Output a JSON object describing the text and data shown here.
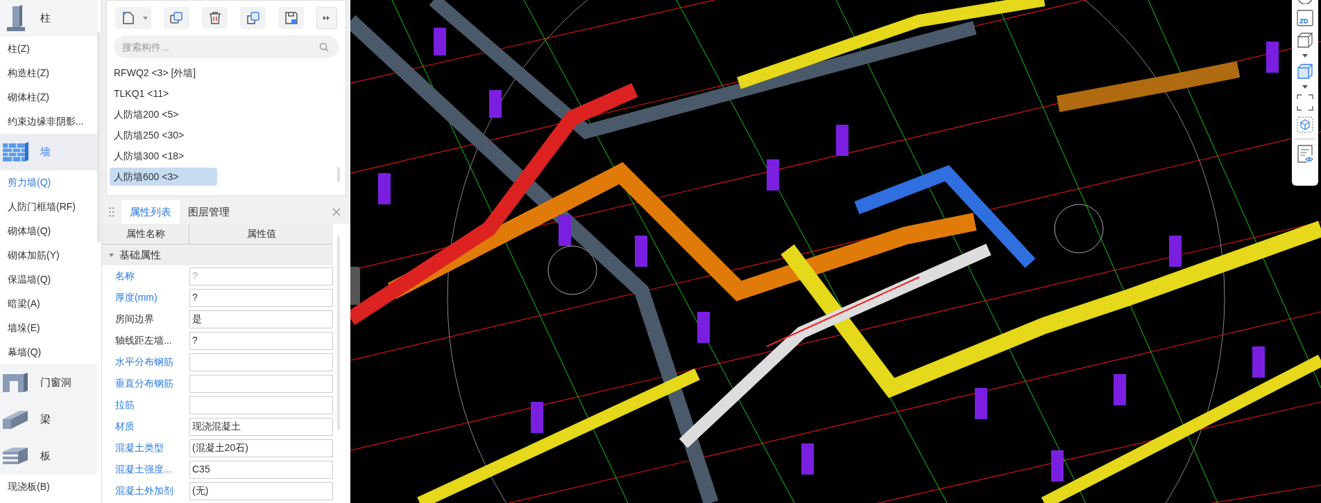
{
  "sidebar": {
    "categories": [
      {
        "label": "柱",
        "selected": false,
        "items": [
          {
            "label": "柱(Z)",
            "selected": false
          },
          {
            "label": "构造柱(Z)",
            "selected": false
          },
          {
            "label": "砌体柱(Z)",
            "selected": false
          },
          {
            "label": "约束边缘非阴影...",
            "selected": false
          }
        ]
      },
      {
        "label": "墙",
        "selected": true,
        "items": [
          {
            "label": "剪力墙(Q)",
            "selected": true
          },
          {
            "label": "人防门框墙(RF)",
            "selected": false
          },
          {
            "label": "砌体墙(Q)",
            "selected": false
          },
          {
            "label": "砌体加筋(Y)",
            "selected": false
          },
          {
            "label": "保温墙(Q)",
            "selected": false
          },
          {
            "label": "暗梁(A)",
            "selected": false
          },
          {
            "label": "墙垛(E)",
            "selected": false
          },
          {
            "label": "幕墙(Q)",
            "selected": false
          }
        ]
      },
      {
        "label": "门窗洞",
        "selected": false
      },
      {
        "label": "梁",
        "selected": false
      },
      {
        "label": "板",
        "selected": false,
        "items": [
          {
            "label": "现浇板(B)",
            "selected": false
          }
        ]
      }
    ]
  },
  "component_panel": {
    "search": {
      "placeholder": "搜索构件..."
    },
    "components": [
      {
        "label": "RFWQ2 <3> [外墙]",
        "selected": false
      },
      {
        "label": "TLKQ1 <11>",
        "selected": false
      },
      {
        "label": "人防墙200 <5>",
        "selected": false
      },
      {
        "label": "人防墙250 <30>",
        "selected": false
      },
      {
        "label": "人防墙300 <18>",
        "selected": false
      },
      {
        "label": "人防墙600 <3>",
        "selected": true
      }
    ]
  },
  "property_panel": {
    "tabs": [
      {
        "label": "属性列表",
        "selected": true
      },
      {
        "label": "图层管理",
        "selected": false
      }
    ],
    "columns": [
      "属性名称",
      "属性值"
    ],
    "group": {
      "label": "基础属性",
      "expanded": true
    },
    "rows": [
      {
        "name": "名称",
        "value": "?",
        "common": true,
        "dimmed": true
      },
      {
        "name": "厚度(mm)",
        "value": "?",
        "common": true,
        "dimmed": false
      },
      {
        "name": "房间边界",
        "value": "是",
        "common": false,
        "dimmed": false
      },
      {
        "name": "轴线距左墙...",
        "value": "?",
        "common": false,
        "dimmed": false
      },
      {
        "name": "水平分布钢筋",
        "common": true,
        "dimmed": false
      },
      {
        "name": "垂直分布钢筋",
        "common": true,
        "dimmed": false
      },
      {
        "name": "拉筋",
        "common": true,
        "dimmed": false
      },
      {
        "name": "材质",
        "value": "现浇混凝土",
        "common": true,
        "dimmed": false
      },
      {
        "name": "混凝土类型",
        "value": "(混凝土20石)",
        "common": true,
        "dimmed": false
      },
      {
        "name": "混凝土强度...",
        "value": "C35",
        "common": true,
        "dimmed": false
      },
      {
        "name": "混凝土外加剂",
        "value": "(无)",
        "common": true,
        "dimmed": false
      }
    ]
  }
}
